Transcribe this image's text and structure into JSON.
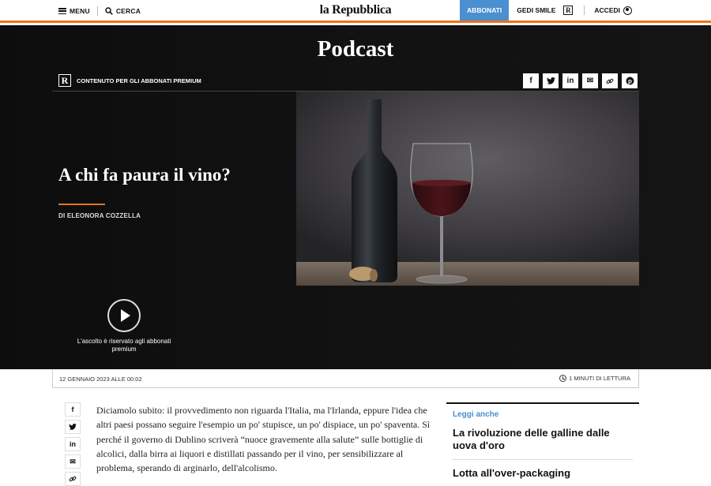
{
  "header": {
    "menu_label": "MENU",
    "search_label": "CERCA",
    "logo": "la Repubblica",
    "subscribe_label": "ABBONATI",
    "gedi_label": "GEDI SMILE",
    "r_badge": "R",
    "login_label": "ACCEDI"
  },
  "hero": {
    "section_title": "Podcast",
    "premium_badge": "R",
    "premium_label": "CONTENUTO PER GLI ABBONATI PREMIUM",
    "share_icons": [
      "f",
      "t",
      "in",
      "✉",
      "🔗",
      "p"
    ],
    "headline": "A chi fa paura il vino?",
    "author": "DI ELEONORA COZZELLA",
    "play_note": "L'ascolto è riservato agli abbonati premium"
  },
  "meta": {
    "date": "12 GENNAIO 2023 ALLE 00:02",
    "reading_time": "1 MINUTI DI LETTURA"
  },
  "article": {
    "side_share": [
      "f",
      "t",
      "in",
      "✉",
      "🔗"
    ],
    "paragraph": "Diciamolo subito: il provvedimento non riguarda l'Italia, ma l'Irlanda, eppure l'idea che altri paesi possano seguire l'esempio un po' stupisce, un po' dispiace, un po' spaventa. Sì perché il governo di Dublino scriverà “nuoce gravemente alla salute” sulle bottiglie di alcolici, dalla birra ai liquori e distillati passando per il vino, per sensibilizzare al problema, sperando di arginarlo, dell'alcolismo."
  },
  "related": {
    "label": "Leggi anche",
    "items": [
      "La rivoluzione delle galline dalle uova d'oro",
      "Lotta all'over-packaging"
    ]
  }
}
